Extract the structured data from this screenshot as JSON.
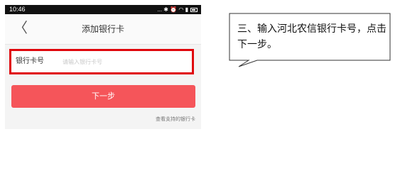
{
  "statusbar": {
    "time": "10:46",
    "icons": "... ✱ ⏰ ◠ ▮"
  },
  "navbar": {
    "back_glyph": "〈",
    "title": "添加银行卡"
  },
  "card_field": {
    "label": "银行卡号",
    "value": "",
    "placeholder": "请输入银行卡号"
  },
  "next_button": {
    "label": "下一步"
  },
  "supported_link": "查看支持的银行卡",
  "callout": {
    "text": "三、输入河北农信银行卡号，点击下一步。"
  },
  "colors": {
    "highlight_border": "#e0070d",
    "button": "#f5555a"
  }
}
